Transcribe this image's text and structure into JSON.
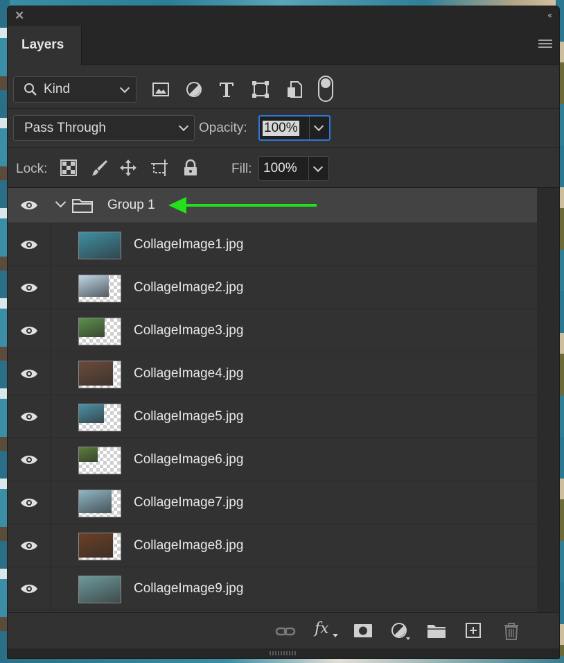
{
  "panel": {
    "tab_title": "Layers"
  },
  "filter": {
    "kind_label": "Kind",
    "icons": [
      "image-filter-icon",
      "adjustment-filter-icon",
      "type-filter-icon",
      "shape-filter-icon",
      "smart-object-filter-icon"
    ]
  },
  "blend": {
    "mode": "Pass Through",
    "opacity_label": "Opacity:",
    "opacity_value": "100%"
  },
  "lock": {
    "label": "Lock:",
    "fill_label": "Fill:",
    "fill_value": "100%"
  },
  "group": {
    "name": "Group 1",
    "arrow_color": "#22e01a"
  },
  "layers": [
    {
      "name": "CollageImage1.jpg",
      "thumb_color": "#3f8fa3",
      "thumb_fill": 1.0
    },
    {
      "name": "CollageImage2.jpg",
      "thumb_color": "#bfd6e6",
      "thumb_fill": 0.72
    },
    {
      "name": "CollageImage3.jpg",
      "thumb_color": "#5d8f4a",
      "thumb_fill": 0.62
    },
    {
      "name": "CollageImage4.jpg",
      "thumb_color": "#6b4a3a",
      "thumb_fill": 0.82
    },
    {
      "name": "CollageImage5.jpg",
      "thumb_color": "#4c91a6",
      "thumb_fill": 0.6
    },
    {
      "name": "CollageImage6.jpg",
      "thumb_color": "#5c7f3a",
      "thumb_fill": 0.45
    },
    {
      "name": "CollageImage7.jpg",
      "thumb_color": "#8fb6c6",
      "thumb_fill": 0.78
    },
    {
      "name": "CollageImage8.jpg",
      "thumb_color": "#6a3f24",
      "thumb_fill": 0.82
    },
    {
      "name": "CollageImage9.jpg",
      "thumb_color": "#6f9a9b",
      "thumb_fill": 1.0
    }
  ],
  "footer_icons": [
    "link-layers-icon",
    "fx-icon",
    "add-mask-icon",
    "adjustment-layer-icon",
    "new-group-icon",
    "new-layer-icon",
    "delete-layer-icon"
  ],
  "footer": {
    "fx_label": "fx"
  }
}
